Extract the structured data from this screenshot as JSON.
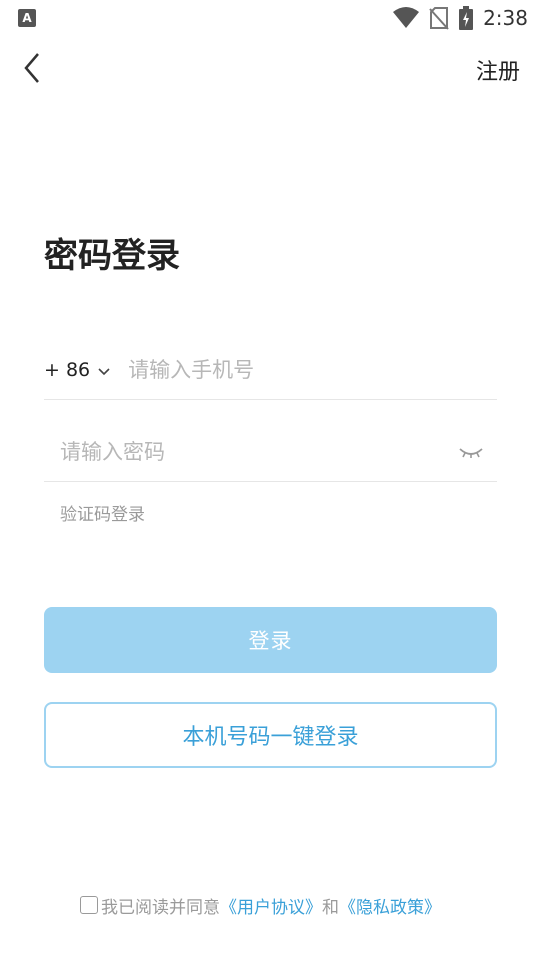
{
  "status_bar": {
    "time": "2:38",
    "left_glyph": "A",
    "icons": [
      "wifi-icon",
      "no-sim-icon",
      "battery-charging-icon"
    ]
  },
  "header": {
    "back_icon": "chevron-left-icon",
    "register_label": "注册"
  },
  "title": "密码登录",
  "phone": {
    "country_code": "+ 86",
    "placeholder": "请输入手机号",
    "dropdown_icon": "chevron-down-icon"
  },
  "password": {
    "placeholder": "请输入密码",
    "toggle_icon": "eye-closed-icon"
  },
  "sms_login_label": "验证码登录",
  "login_button_label": "登录",
  "one_click_login_label": "本机号码一键登录",
  "agreement": {
    "prefix": "我已阅读并同意",
    "user_agreement": "《用户协议》",
    "and": "和",
    "privacy_policy": "《隐私政策》"
  },
  "colors": {
    "accent": "#3aa0d8",
    "button_disabled": "#9dd3f1",
    "placeholder": "#b7b7b7"
  }
}
